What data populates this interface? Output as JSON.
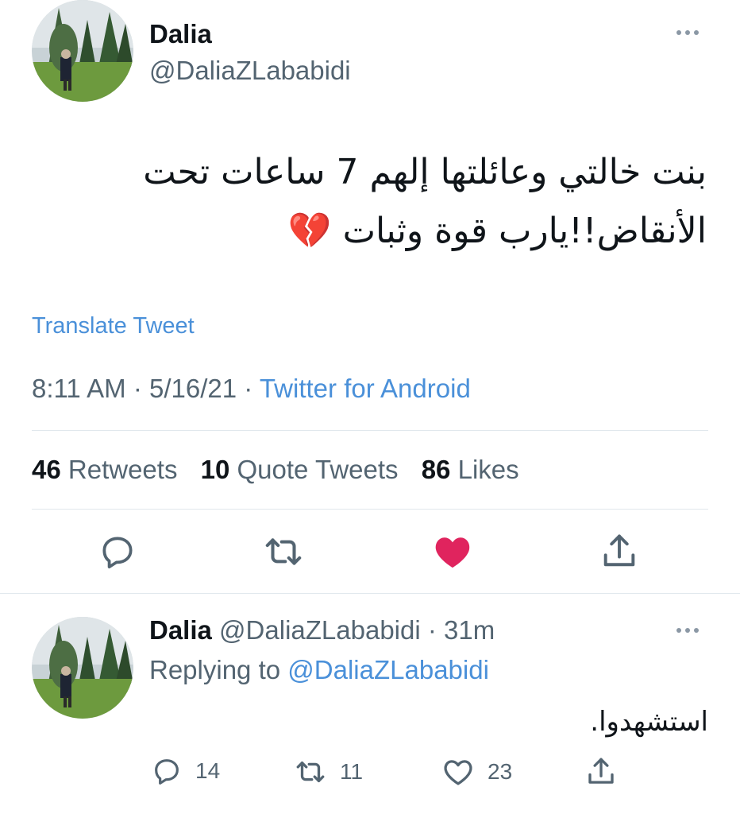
{
  "main_tweet": {
    "author_name": "Dalia",
    "author_handle": "@DaliaZLababidi",
    "text_line1": "بنت خالتي وعائلتها إلهم 7 ساعات تحت",
    "text_line2": "الأنقاض!!يارب قوة وثبات 💔",
    "translate_label": "Translate Tweet",
    "time": "8:11 AM",
    "date": "5/16/21",
    "separator": "·",
    "source": "Twitter for Android",
    "retweets_count": "46",
    "retweets_label": "Retweets",
    "quotes_count": "10",
    "quotes_label": "Quote Tweets",
    "likes_count": "86",
    "likes_label": "Likes",
    "liked": true
  },
  "reply_tweet": {
    "author_name": "Dalia",
    "author_handle": "@DaliaZLababidi",
    "time_ago": "· 31m",
    "replying_prefix": "Replying to",
    "replying_to": "@DaliaZLababidi",
    "text": "استشهدوا.",
    "reply_count": "14",
    "retweet_count": "11",
    "like_count": "23"
  },
  "icons": [
    "more-icon",
    "reply-icon",
    "retweet-icon",
    "heart-icon",
    "share-icon"
  ],
  "colors": {
    "like": "#e0245e",
    "link": "#4a90d9",
    "muted": "#536471",
    "icon": "#536471"
  }
}
